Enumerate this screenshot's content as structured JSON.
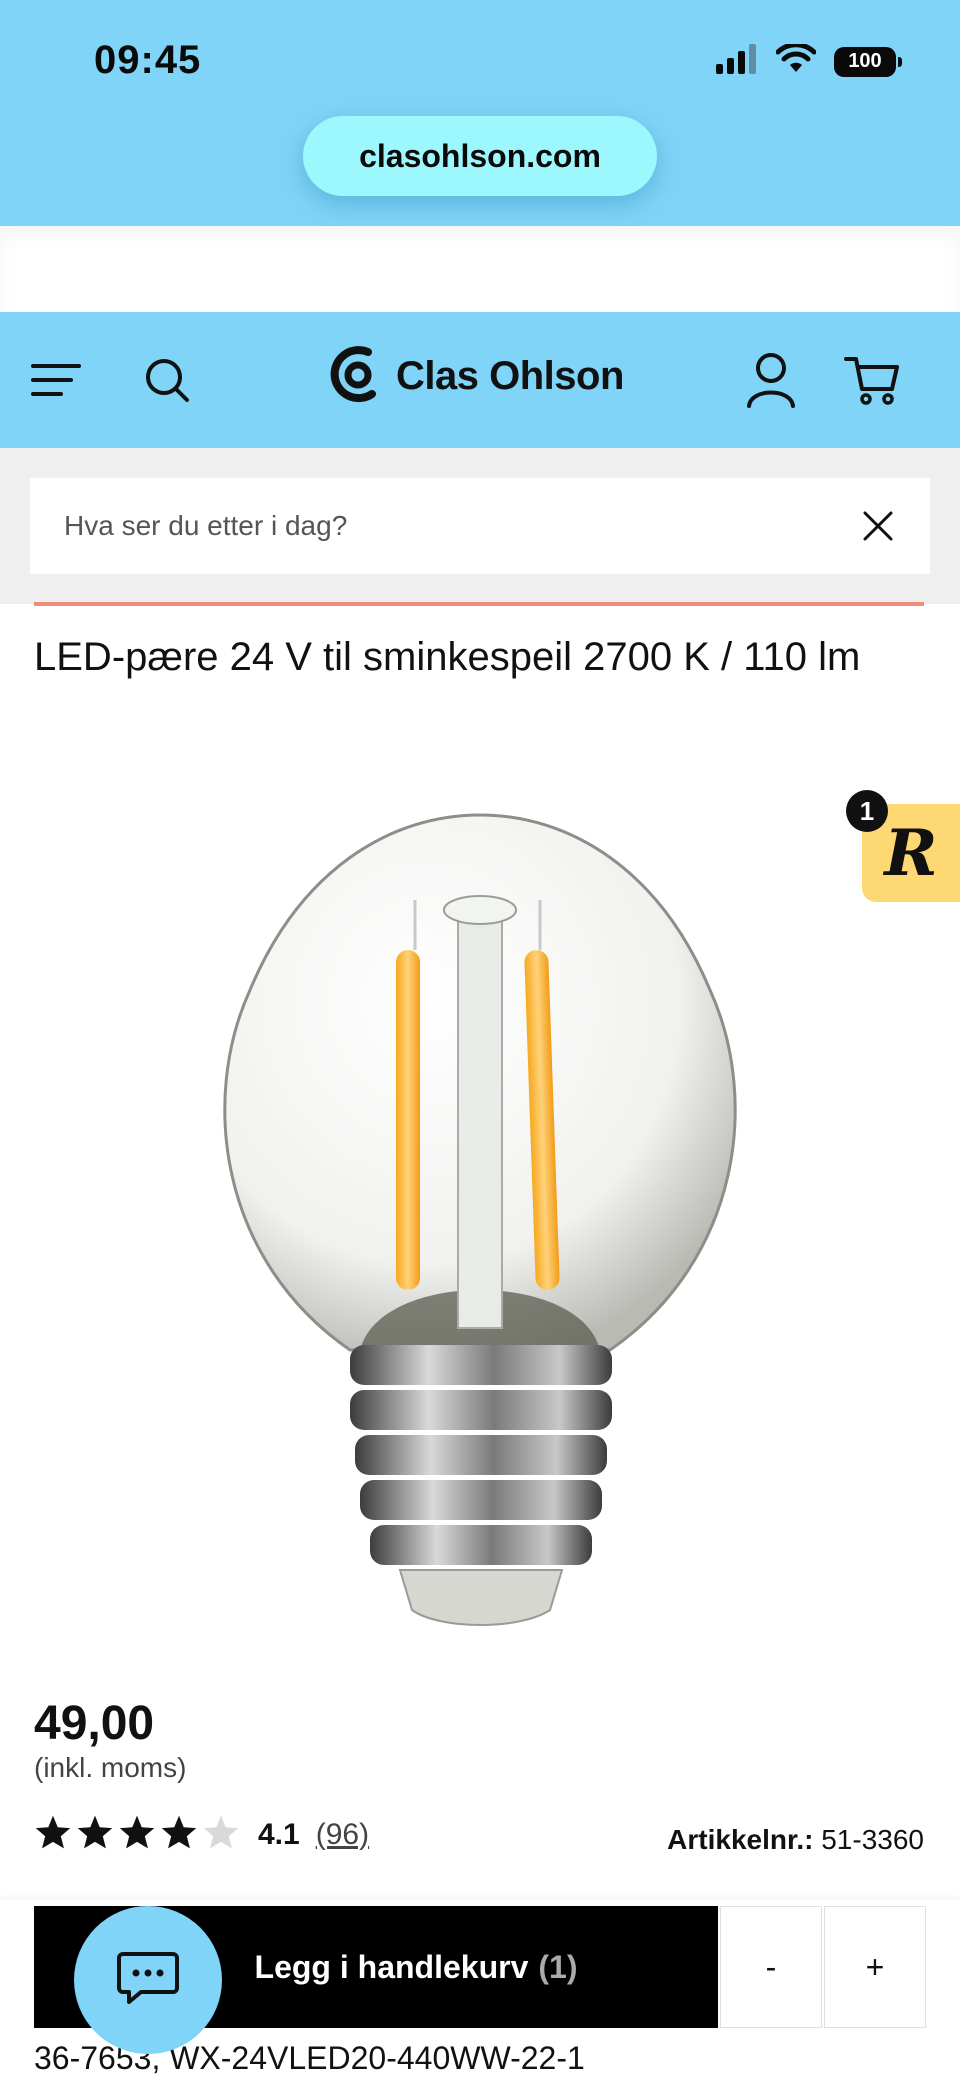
{
  "status_bar": {
    "time": "09:45",
    "battery": "100",
    "icons": [
      "signal-icon",
      "wifi-icon",
      "battery-icon"
    ]
  },
  "browser": {
    "url": "clasohlson.com"
  },
  "header": {
    "logo_text": "Clas Ohlson",
    "icons": [
      "menu-icon",
      "search-icon",
      "user-icon",
      "cart-icon"
    ],
    "background": "#7fd4f7"
  },
  "search": {
    "placeholder": "Hva ser du etter i dag?",
    "value": ""
  },
  "product": {
    "title": "LED-pære 24 V til sminkespeil 2700 K / 110 lm",
    "price": "49,00",
    "price_note": "(inkl. moms)",
    "rating_value": "4.1",
    "rating_count": "(96)",
    "rating_stars": 4.1,
    "article_label": "Artikkelnr.:",
    "article_number": "51-3360",
    "codes": "36-7653, WX-24VLED20-440WW-22-1"
  },
  "badge": {
    "letter": "R",
    "count": "1"
  },
  "cart": {
    "add_label": "Legg i handlekurv",
    "count": "(1)",
    "minus": "-",
    "plus": "+"
  },
  "colors": {
    "accent": "#7fd4f7",
    "pill": "#9cf8fc",
    "badge": "#fed872",
    "line": "#f08c7a"
  }
}
